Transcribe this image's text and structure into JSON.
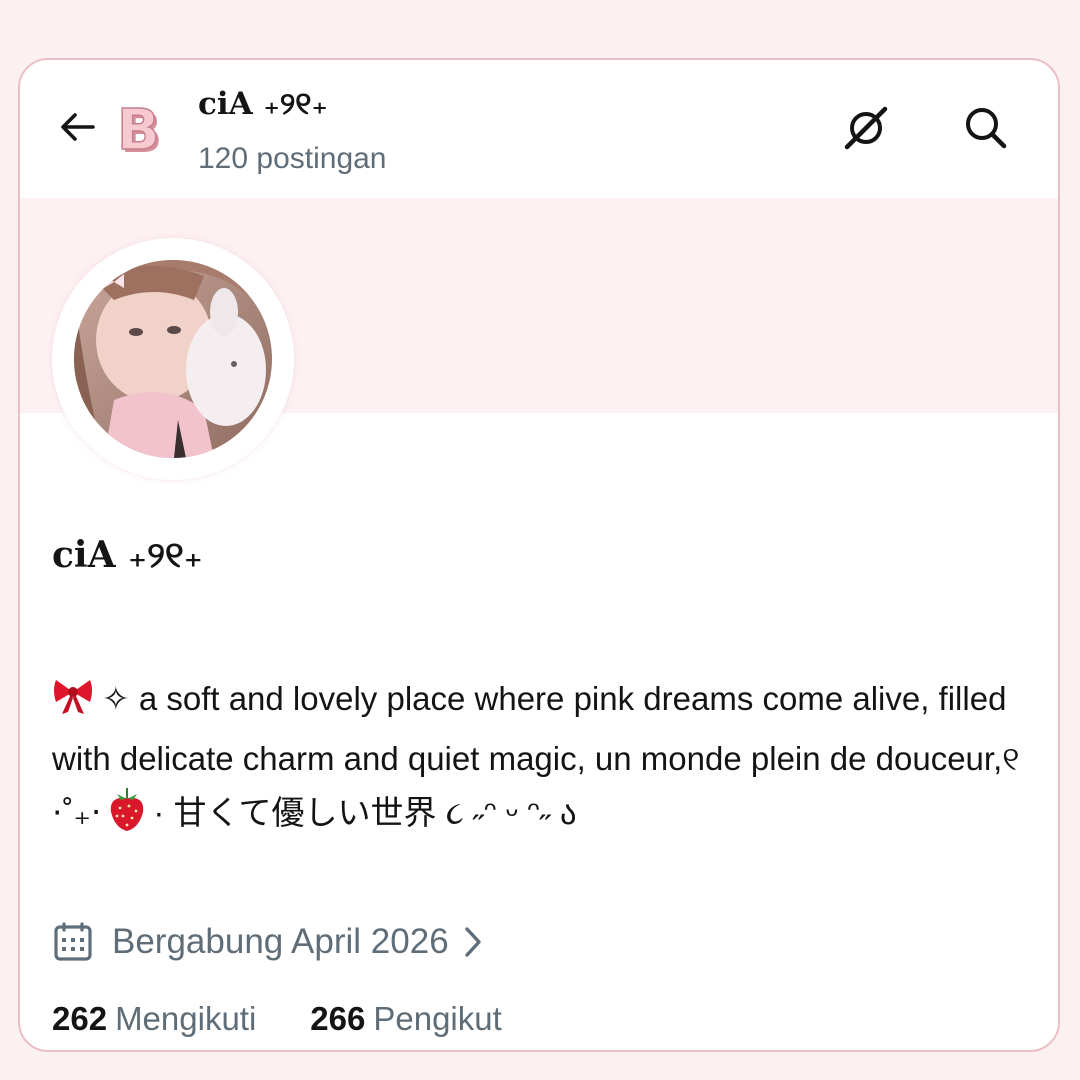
{
  "header": {
    "title": "ciA ₊୨୧₊",
    "post_count": "120 postingan",
    "logo_letter": "B"
  },
  "profile": {
    "display_name": "ciA ₊୨୧₊",
    "bio": {
      "part1": "✧ a soft and lovely place where pink dreams come alive, filled with delicate charm and quiet magic, un monde plein de douceur,୧ ⋅˚₊‧",
      "part2": "· 甘くて優しい世界 ૮ ˶ᵔ ᵕ ᵔ˶ ა"
    },
    "joined": "Bergabung April 2026",
    "following_count": "262",
    "following_label": "Mengikuti",
    "followers_count": "266",
    "followers_label": "Pengikut"
  },
  "icons": {
    "back": "arrow-left-icon",
    "logo": "letter-b-logo",
    "grok": "grok-slash-icon",
    "search": "search-icon",
    "calendar": "calendar-icon",
    "chevron": "chevron-right-icon",
    "bow": "ribbon-bow-icon",
    "strawberry": "strawberry-icon"
  },
  "colors": {
    "background": "#fbf1f3",
    "card_border": "#ebbfc4",
    "banner": "#fdf1f3",
    "text": "#141414",
    "muted": "#5f6d78",
    "logo_pink": "#f2b3bd"
  }
}
